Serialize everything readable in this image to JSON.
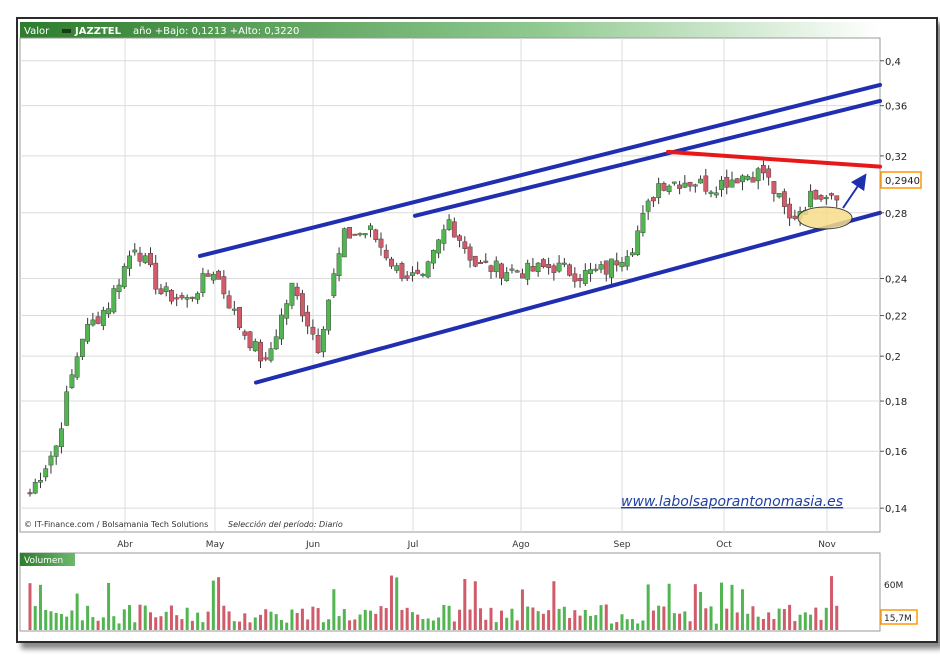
{
  "header": {
    "label": "Valor",
    "ticker": "JAZZTEL",
    "stats": "año +Bajo: 0,1213 +Alto: 0,3220"
  },
  "footer": {
    "credit": "© IT-Finance.com / Bolsamania Tech Solutions",
    "period": "Selección del período: Diario"
  },
  "watermark": "www.labolsaporantonomasia.es",
  "volume_panel": {
    "label": "Volumen",
    "ticks": [
      "60M"
    ],
    "last_value": "15,7M"
  },
  "colors": {
    "up": "#52b552",
    "down": "#cf5b6b",
    "channel": "#1f2fb0",
    "resistance": "#e81818",
    "last_price_box": "#ff9900",
    "header_bg": "#2e7d2e"
  },
  "chart_data": {
    "type": "candlestick",
    "title": "JAZZTEL",
    "y_scale": "log",
    "ylim": [
      0.133,
      0.42
    ],
    "y_ticks": [
      "0,4",
      "0,36",
      "0,32",
      "0,28",
      "0,24",
      "0,22",
      "0,2",
      "0,18",
      "0,16",
      "0,14"
    ],
    "y_tick_values": [
      0.4,
      0.36,
      0.32,
      0.28,
      0.24,
      0.22,
      0.2,
      0.18,
      0.16,
      0.14
    ],
    "x_labels": [
      "Abr",
      "May",
      "Jun",
      "Jul",
      "Ago",
      "Sep",
      "Oct",
      "Nov"
    ],
    "last_price": "0,2940",
    "grid": true,
    "close_by_week": [
      {
        "week": "Mar-W3",
        "close": 0.145
      },
      {
        "week": "Mar-W4",
        "close": 0.162
      },
      {
        "week": "Abr-W1",
        "close": 0.21
      },
      {
        "week": "Abr-W2",
        "close": 0.226
      },
      {
        "week": "Abr-W3",
        "close": 0.26
      },
      {
        "week": "Abr-W4",
        "close": 0.232
      },
      {
        "week": "May-W1",
        "close": 0.228
      },
      {
        "week": "May-W2",
        "close": 0.245
      },
      {
        "week": "May-W3",
        "close": 0.215
      },
      {
        "week": "May-W4",
        "close": 0.196
      },
      {
        "week": "Jun-W1",
        "close": 0.235
      },
      {
        "week": "Jun-W2",
        "close": 0.205
      },
      {
        "week": "Jun-W3",
        "close": 0.265
      },
      {
        "week": "Jun-W4",
        "close": 0.268
      },
      {
        "week": "Jul-W1",
        "close": 0.245
      },
      {
        "week": "Jul-W2",
        "close": 0.238
      },
      {
        "week": "Jul-W3",
        "close": 0.275
      },
      {
        "week": "Jul-W4",
        "close": 0.248
      },
      {
        "week": "Ago-W1",
        "close": 0.245
      },
      {
        "week": "Ago-W2",
        "close": 0.244
      },
      {
        "week": "Ago-W3",
        "close": 0.247
      },
      {
        "week": "Ago-W4",
        "close": 0.242
      },
      {
        "week": "Sep-W1",
        "close": 0.245
      },
      {
        "week": "Sep-W2",
        "close": 0.26
      },
      {
        "week": "Sep-W3",
        "close": 0.3
      },
      {
        "week": "Sep-W4",
        "close": 0.302
      },
      {
        "week": "Oct-W1",
        "close": 0.298
      },
      {
        "week": "Oct-W2",
        "close": 0.305
      },
      {
        "week": "Oct-W3",
        "close": 0.308
      },
      {
        "week": "Oct-W4",
        "close": 0.275
      },
      {
        "week": "Nov-W1",
        "close": 0.294
      }
    ],
    "trend_lines": [
      {
        "name": "upper-channel-outer",
        "color": "blue",
        "from": {
          "date": "Abr-end",
          "price": 0.253
        },
        "to": {
          "date": "Nov-end",
          "price": 0.378
        }
      },
      {
        "name": "upper-channel-inner",
        "color": "blue",
        "from": {
          "date": "Jul-W1",
          "price": 0.278
        },
        "to": {
          "date": "Nov-end",
          "price": 0.364
        }
      },
      {
        "name": "support",
        "color": "blue",
        "from": {
          "date": "May-W3",
          "price": 0.188
        },
        "to": {
          "date": "Nov-end",
          "price": 0.28
        }
      },
      {
        "name": "resistance",
        "color": "red",
        "from": {
          "date": "Sep-W3",
          "price": 0.323
        },
        "to": {
          "date": "Nov-end",
          "price": 0.312
        }
      }
    ]
  }
}
